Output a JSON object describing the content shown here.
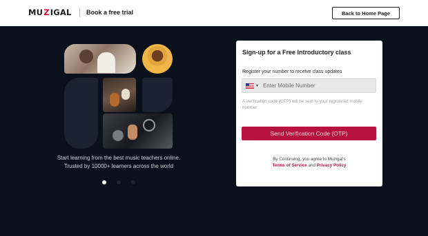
{
  "header": {
    "logo_left": "MU",
    "logo_mark": "Z",
    "logo_right": "IGAL",
    "book_trial": "Book a free trial",
    "back_home": "Back to Home Page"
  },
  "hero": {
    "tagline_line1": "Start learning from the best music teachers online.",
    "tagline_line2": "Trusted by 10000+ learners across the world",
    "carousel": {
      "count": 3,
      "active_index": 0
    }
  },
  "signup": {
    "title": "Sign-up for a Free Introductory class",
    "register_label": "Register your number to receive class updates",
    "phone": {
      "country_flag": "us-flag-icon",
      "placeholder": "Enter Mobile Number",
      "value": ""
    },
    "otp_note": "A verification code (OTP) will be sent to your registered mobile number",
    "send_button": "Send Verification Code (OTP)",
    "consent_prefix": "By Continuing, you agree to Muzigal's",
    "terms_link": "Terms of Service",
    "and_text": "and",
    "privacy_link": "Privacy Policy"
  },
  "colors": {
    "brand_red": "#c8102e",
    "button_red": "#b8123e",
    "background": "#0b111c"
  }
}
